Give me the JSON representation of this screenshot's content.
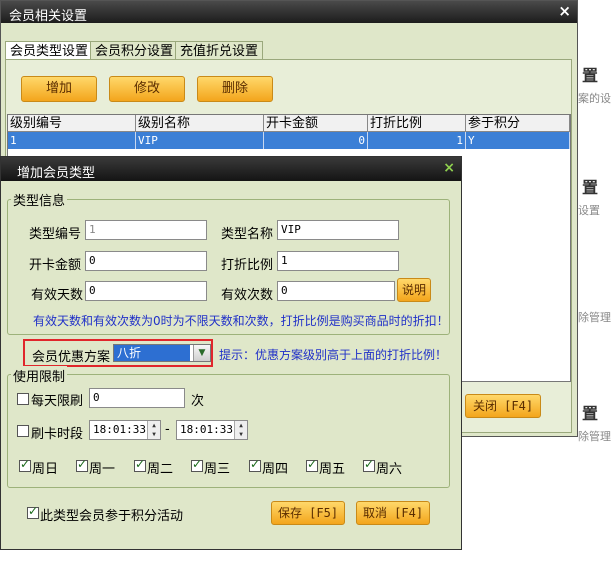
{
  "background": {
    "heading1": "置",
    "text1": "案的设",
    "heading2": "置",
    "text2": "设置",
    "text3": "除管理",
    "heading3": "置",
    "text4": "除管理"
  },
  "outer_window": {
    "title": "会员相关设置",
    "close_glyph": "×",
    "tabs": [
      "会员类型设置",
      "会员积分设置",
      "充值折兑设置"
    ],
    "toolbar": {
      "add": "增加",
      "edit": "修改",
      "delete": "删除"
    },
    "table": {
      "headers": [
        "级别编号",
        "级别名称",
        "开卡金额",
        "打折比例",
        "参于积分"
      ],
      "rows": [
        [
          "1",
          "VIP",
          "0",
          "1",
          "Y"
        ]
      ]
    },
    "close_button": "关闭 [F4]"
  },
  "dialog": {
    "title": "增加会员类型",
    "close_glyph": "×",
    "type_info": {
      "legend": "类型信息",
      "type_code_label": "类型编号",
      "type_code_value": "1",
      "type_name_label": "类型名称",
      "type_name_value": "VIP",
      "open_amount_label": "开卡金额",
      "open_amount_value": "0",
      "discount_label": "打折比例",
      "discount_value": "1",
      "valid_days_label": "有效天数",
      "valid_days_value": "0",
      "valid_times_label": "有效次数",
      "valid_times_value": "0",
      "explain_button": "说明",
      "note": "有效天数和有效次数为0时为不限天数和次数，打折比例是购买商品时的折扣！"
    },
    "plan": {
      "label": "会员优惠方案",
      "selected": "八折",
      "hint": "提示：优惠方案级别高于上面的打折比例！"
    },
    "usage": {
      "legend": "使用限制",
      "daily_label": "每天限刷",
      "daily_value": "0",
      "daily_unit": "次",
      "period_label": "刷卡时段",
      "time_start": "18:01:33",
      "time_sep": "-",
      "time_end": "18:01:33",
      "weekdays": [
        "周日",
        "周一",
        "周二",
        "周三",
        "周四",
        "周五",
        "周六"
      ]
    },
    "points_label": "此类型会员参于积分活动",
    "save_button": "保存 [F5]",
    "cancel_button": "取消 [F4]"
  }
}
